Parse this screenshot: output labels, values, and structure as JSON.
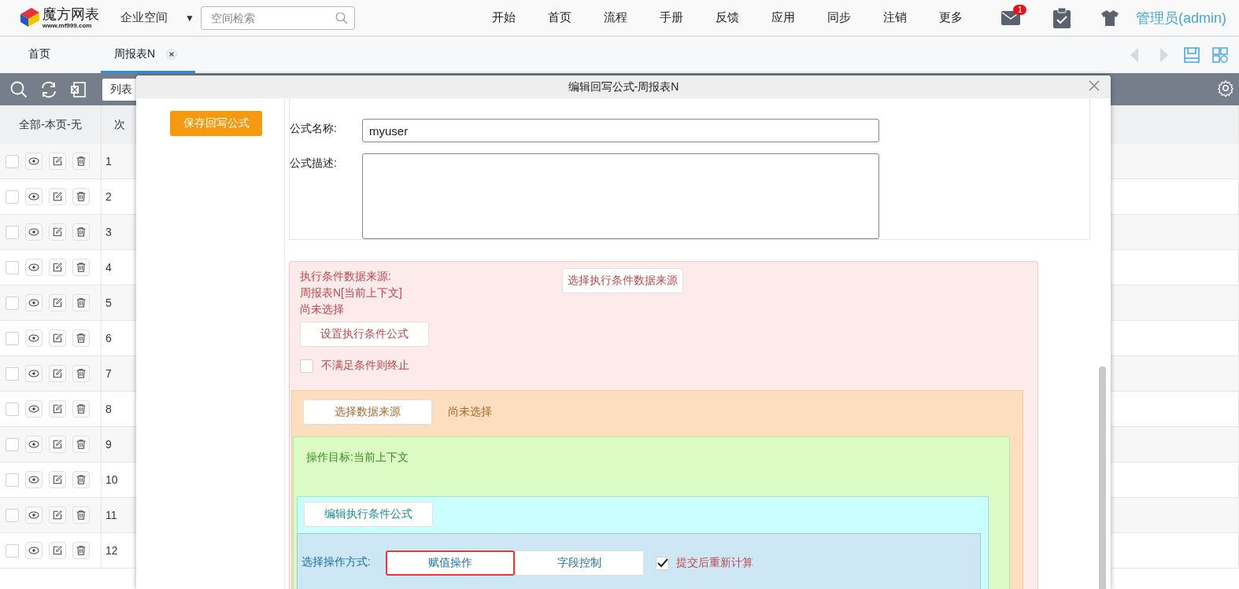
{
  "header": {
    "logo": {
      "name": "魔方网表",
      "url": "www.mf999.com"
    },
    "space": "企业空间",
    "space_caret": "▼",
    "search": {
      "placeholder": "空间检索"
    },
    "nav": [
      "开始",
      "首页",
      "流程",
      "手册",
      "反馈",
      "应用",
      "同步",
      "注销",
      "更多"
    ],
    "mail_badge": "1",
    "user": "管理员(admin)"
  },
  "tabs": [
    {
      "label": "首页",
      "selected": false,
      "closable": false
    },
    {
      "label": "周报表N",
      "selected": true,
      "closable": true
    }
  ],
  "toolbar": {
    "view_select": "列表"
  },
  "table": {
    "columns": [
      "全部-本页-无",
      "次"
    ],
    "rows": [
      {
        "checked": false,
        "index": "1"
      },
      {
        "checked": false,
        "index": "2"
      },
      {
        "checked": false,
        "index": "3"
      },
      {
        "checked": false,
        "index": "4"
      },
      {
        "checked": false,
        "index": "5"
      },
      {
        "checked": false,
        "index": "6"
      },
      {
        "checked": false,
        "index": "7"
      },
      {
        "checked": false,
        "index": "8"
      },
      {
        "checked": false,
        "index": "9"
      },
      {
        "checked": false,
        "index": "10"
      },
      {
        "checked": false,
        "index": "11"
      },
      {
        "checked": false,
        "index": "12"
      }
    ]
  },
  "dialog": {
    "title": "编辑回写公式-周报表N",
    "save_button": "保存回写公式",
    "form": {
      "name_label": "公式名称:",
      "name_value": "myuser",
      "desc_label": "公式描述:"
    },
    "condition": {
      "lines": [
        "执行条件数据来源:",
        "周报表N[当前上下文]",
        "尚未选择"
      ],
      "select_button": "选择执行条件数据来源",
      "set_button": "设置执行条件公式",
      "stop": {
        "label": "不满足条件则终止",
        "checked": false
      }
    },
    "source": {
      "button": "选择数据来源",
      "status": "尚未选择"
    },
    "target": {
      "label": "操作目标:当前上下文"
    },
    "edit_button": "编辑执行条件公式",
    "operation": {
      "label": "选择操作方式:",
      "options": [
        {
          "label": "赋值操作",
          "selected": true
        },
        {
          "label": "字段控制",
          "selected": false
        }
      ],
      "recalc": {
        "label": "提交后重新计算",
        "checked": true
      }
    }
  }
}
